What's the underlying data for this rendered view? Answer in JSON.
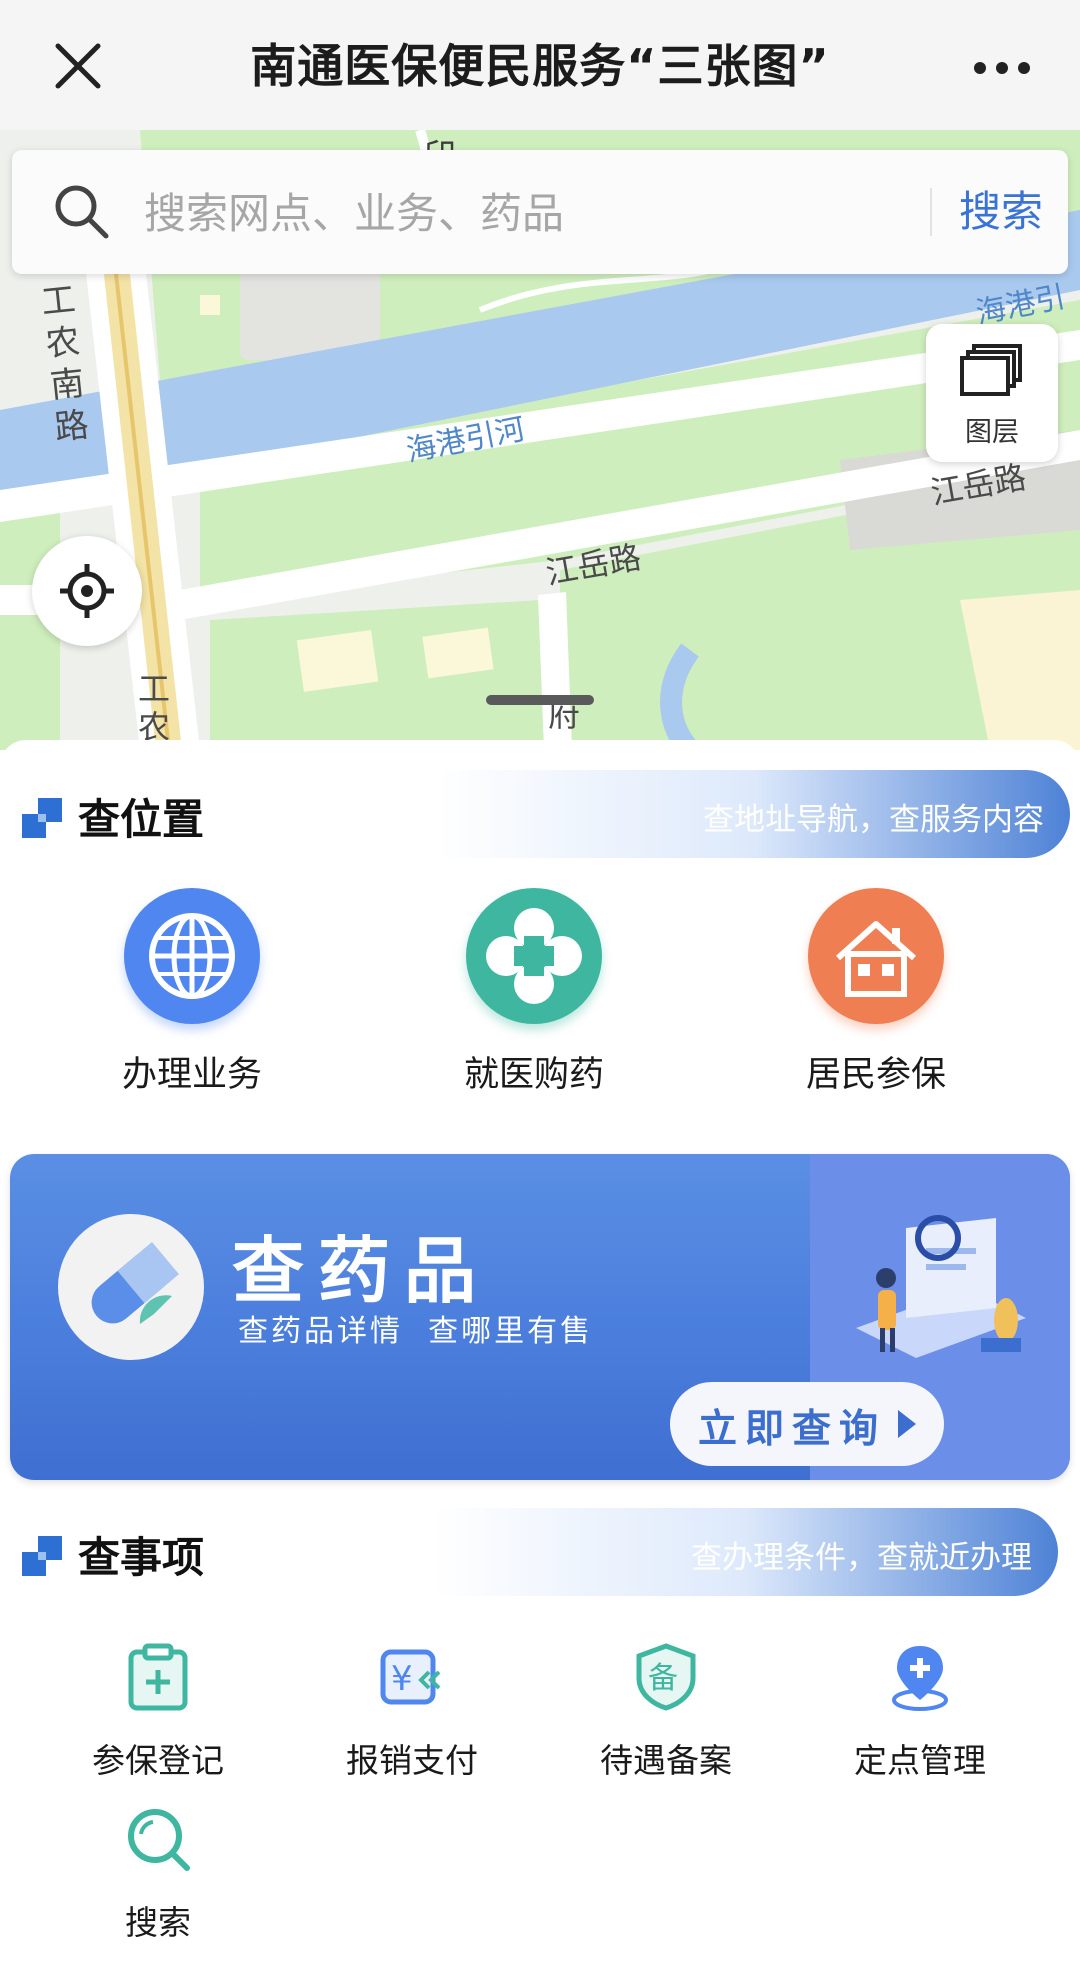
{
  "nav": {
    "title": "南通医保便民服务“三张图”",
    "close_icon": "close-icon",
    "more_icon": "more-icon"
  },
  "search": {
    "placeholder": "搜索网点、业务、药品",
    "button_label": "搜索"
  },
  "map": {
    "layer_button_label": "图层",
    "road_labels": [
      "工农南路",
      "江岳路",
      "江岳路",
      "府",
      "工农"
    ],
    "river_labels": [
      "海港引河",
      "海港引"
    ],
    "landmark_label": "印"
  },
  "section_location": {
    "title": "查位置",
    "subtitle": "查地址导航，查服务内容",
    "items": [
      {
        "label": "办理业务",
        "icon": "globe-icon",
        "color": "#4f86f0"
      },
      {
        "label": "就医购药",
        "icon": "medical-cross-icon",
        "color": "#3fb7a0"
      },
      {
        "label": "居民参保",
        "icon": "house-icon",
        "color": "#ef7e52"
      }
    ]
  },
  "banner": {
    "title": "查药品",
    "subtitle": "查药品详情  查哪里有售",
    "cta_label": "立即查询"
  },
  "section_matters": {
    "title": "查事项",
    "subtitle": "查办理条件，查就近办理",
    "items": [
      {
        "label": "参保登记",
        "icon": "clipboard-plus-icon"
      },
      {
        "label": "报销支付",
        "icon": "yuan-payment-icon"
      },
      {
        "label": "待遇备案",
        "icon": "shield-record-icon"
      },
      {
        "label": "定点管理",
        "icon": "location-pin-plus-icon"
      },
      {
        "label": "搜索",
        "icon": "search-icon"
      }
    ]
  },
  "colors": {
    "accent_blue": "#3a73d6",
    "teal_icon": "#3fb7a0"
  }
}
